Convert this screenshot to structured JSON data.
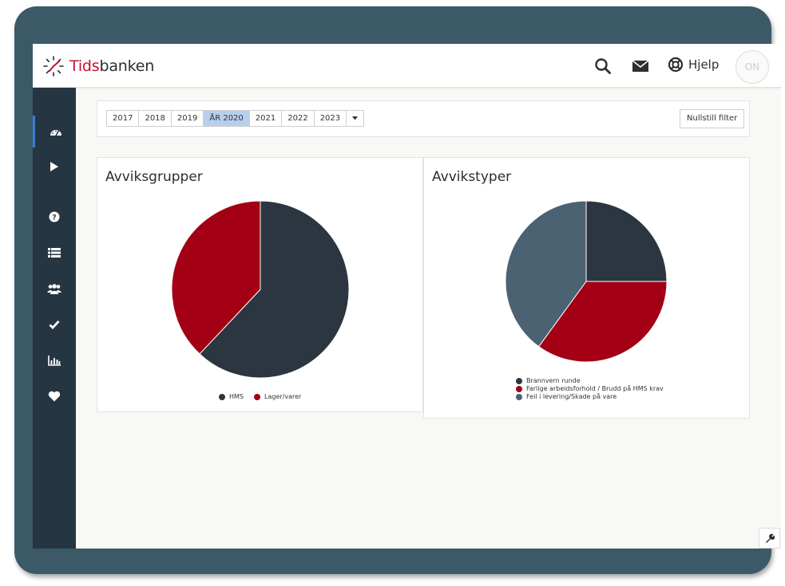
{
  "app": {
    "logo_part1": "Tids",
    "logo_part2": "banken"
  },
  "header": {
    "help_label": "Hjelp",
    "toggle_label": "ON"
  },
  "sidebar": {
    "items": [
      {
        "icon": "dashboard-icon",
        "active": true
      },
      {
        "icon": "play-icon"
      },
      {
        "icon": "question-icon"
      },
      {
        "icon": "list-icon"
      },
      {
        "icon": "users-icon"
      },
      {
        "icon": "check-icon"
      },
      {
        "icon": "bar-chart-icon"
      },
      {
        "icon": "heart-icon"
      }
    ]
  },
  "filter": {
    "years": [
      "2017",
      "2018",
      "2019",
      "ÅR 2020",
      "2021",
      "2022",
      "2023"
    ],
    "selected": "ÅR 2020",
    "reset_label": "Nullstill filter"
  },
  "colors": {
    "dark": "#2b3640",
    "red": "#a30015",
    "slate": "#4a6272",
    "accent": "#3a7bd5"
  },
  "chart_data": [
    {
      "type": "pie",
      "title": "Avviksgrupper",
      "labels": [
        "HMS",
        "Lager/varer"
      ],
      "values": [
        62,
        38
      ],
      "colors": [
        "#2b3640",
        "#a30015"
      ],
      "legend_position": "bottom"
    },
    {
      "type": "pie",
      "title": "Avvikstyper",
      "labels": [
        "Brannvern runde",
        "Farlige arbeidsforhold / Brudd på HMS krav",
        "Feil i levering/Skade på vare"
      ],
      "values": [
        25,
        35,
        40
      ],
      "colors": [
        "#2b3640",
        "#a30015",
        "#4a6272"
      ],
      "legend_position": "bottom"
    }
  ]
}
